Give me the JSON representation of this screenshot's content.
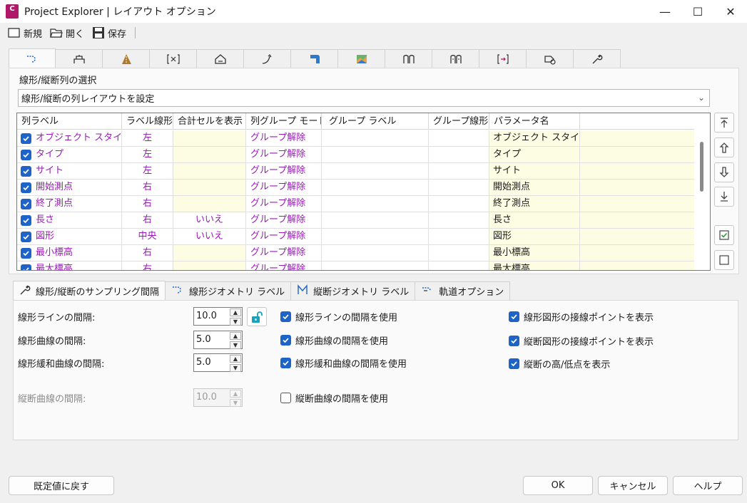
{
  "window": {
    "title": "Project Explorer | レイアウト オプション",
    "app_icon_text": "C",
    "minimize": "—",
    "maximize": "☐",
    "close": "✕"
  },
  "toolbar": {
    "new_label": "新規",
    "open_label": "開く",
    "save_label": "保存"
  },
  "top_tabs": [
    {
      "icon": "alignment-icon",
      "glyph": "ﾞ⊃",
      "active": true
    },
    {
      "icon": "bridge-icon",
      "glyph": "⛨"
    },
    {
      "icon": "road-icon",
      "glyph": "◢"
    },
    {
      "icon": "section-icon",
      "glyph": "[◈]"
    },
    {
      "icon": "house-icon",
      "glyph": "⌂"
    },
    {
      "icon": "curve-icon",
      "glyph": "⤴"
    },
    {
      "icon": "blue-shape-icon",
      "glyph": "◰"
    },
    {
      "icon": "map-icon",
      "glyph": "▨"
    },
    {
      "icon": "profile-icon",
      "glyph": "⊓"
    },
    {
      "icon": "profile-view-icon",
      "glyph": "⊓"
    },
    {
      "icon": "bracket-icon",
      "glyph": "[·]"
    },
    {
      "icon": "tag-icon",
      "glyph": "⌂"
    },
    {
      "icon": "wrench-icon",
      "glyph": "⚒"
    }
  ],
  "main": {
    "section_label": "線形/縦断列の選択",
    "combo_value": "線形/縦断の列レイアウトを設定",
    "columns": [
      "列ラベル",
      "ラベル線形",
      "合計セルを表示",
      "列グループ モード",
      "グループ ラベル",
      "グループ線形",
      "パラメータ名",
      ""
    ],
    "rows": [
      {
        "label": "オブジェクト スタイル",
        "align": "左",
        "total": "",
        "mode": "グループ解除",
        "group_label": "",
        "group_align": "",
        "param": "オブジェクト スタイル"
      },
      {
        "label": "タイプ",
        "align": "左",
        "total": "",
        "mode": "グループ解除",
        "group_label": "",
        "group_align": "",
        "param": "タイプ"
      },
      {
        "label": "サイト",
        "align": "左",
        "total": "",
        "mode": "グループ解除",
        "group_label": "",
        "group_align": "",
        "param": "サイト"
      },
      {
        "label": "開始測点",
        "align": "右",
        "total": "",
        "mode": "グループ解除",
        "group_label": "",
        "group_align": "",
        "param": "開始測点"
      },
      {
        "label": "終了測点",
        "align": "右",
        "total": "",
        "mode": "グループ解除",
        "group_label": "",
        "group_align": "",
        "param": "終了測点"
      },
      {
        "label": "長さ",
        "align": "右",
        "total": "いいえ",
        "mode": "グループ解除",
        "group_label": "",
        "group_align": "",
        "param": "長さ"
      },
      {
        "label": "図形",
        "align": "中央",
        "total": "いいえ",
        "mode": "グループ解除",
        "group_label": "",
        "group_align": "",
        "param": "図形"
      },
      {
        "label": "最小標高",
        "align": "右",
        "total": "",
        "mode": "グループ解除",
        "group_label": "",
        "group_align": "",
        "param": "最小標高"
      },
      {
        "label": "最大標高",
        "align": "右",
        "total": "",
        "mode": "グループ解除",
        "group_label": "",
        "group_align": "",
        "param": "最大標高"
      }
    ]
  },
  "side_buttons": [
    "move-top-icon",
    "move-up-icon",
    "move-down-icon",
    "move-bottom-icon",
    "check-all-icon",
    "uncheck-all-icon"
  ],
  "bottom_tabs": [
    {
      "label": "線形/縦断のサンプリング間隔",
      "active": true
    },
    {
      "label": "線形ジオメトリ ラベル"
    },
    {
      "label": "縦断ジオメトリ ラベル"
    },
    {
      "label": "軌道オプション"
    }
  ],
  "sampling": {
    "line_interval_label": "線形ラインの間隔:",
    "line_interval_value": "10.0",
    "curve_interval_label": "線形曲線の間隔:",
    "curve_interval_value": "5.0",
    "spiral_interval_label": "線形緩和曲線の間隔:",
    "spiral_interval_value": "5.0",
    "vcurve_interval_label": "縦断曲線の間隔:",
    "vcurve_interval_value": "10.0",
    "use_line_label": "線形ラインの間隔を使用",
    "use_curve_label": "線形曲線の間隔を使用",
    "use_spiral_label": "線形緩和曲線の間隔を使用",
    "use_vcurve_label": "縦断曲線の間隔を使用",
    "show_align_tangent_label": "線形図形の接線ポイントを表示",
    "show_profile_tangent_label": "縦断図形の接線ポイントを表示",
    "show_high_low_label": "縦断の高/低点を表示"
  },
  "footer": {
    "reset_label": "既定値に戻す",
    "ok_label": "OK",
    "cancel_label": "キャンセル",
    "help_label": "ヘルプ"
  },
  "colors": {
    "accent": "#1e64c8",
    "purple_text": "#9a1ab8",
    "param_bg": "#fdfde3",
    "app_icon": "#b0186a"
  }
}
